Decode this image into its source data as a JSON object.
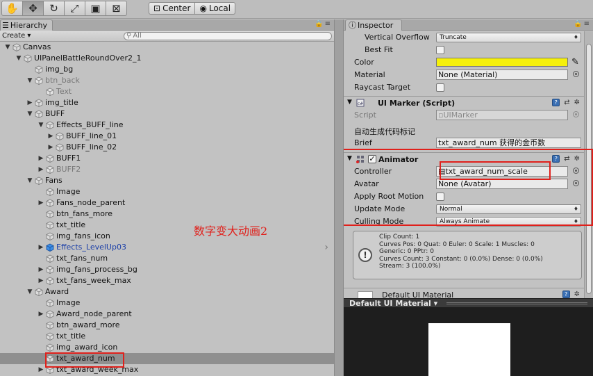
{
  "toolbar": {
    "tools": [
      {
        "icon": "hand-icon",
        "glyph": "✋"
      },
      {
        "icon": "move-icon",
        "glyph": "✥"
      },
      {
        "icon": "rotate-icon",
        "glyph": "↻"
      },
      {
        "icon": "scale-icon",
        "glyph": "⤢"
      },
      {
        "icon": "rect-icon",
        "glyph": "▣"
      },
      {
        "icon": "transform-icon",
        "glyph": "⊠"
      }
    ],
    "pivot": {
      "label": "Center"
    },
    "space": {
      "label": "Local"
    }
  },
  "hierarchy": {
    "tab_label": "Hierarchy",
    "create_label": "Create",
    "search_placeholder": "All",
    "rows": [
      {
        "label": "Canvas",
        "depth": 0,
        "arrow": "down",
        "state": "normal"
      },
      {
        "label": "UIPanelBattleRoundOver2_1",
        "depth": 1,
        "arrow": "down",
        "state": "normal"
      },
      {
        "label": "img_bg",
        "depth": 2,
        "arrow": "none",
        "state": "normal"
      },
      {
        "label": "btn_back",
        "depth": 2,
        "arrow": "down",
        "state": "inactive"
      },
      {
        "label": "Text",
        "depth": 3,
        "arrow": "none",
        "state": "inactive"
      },
      {
        "label": "img_title",
        "depth": 2,
        "arrow": "right",
        "state": "normal"
      },
      {
        "label": "BUFF",
        "depth": 2,
        "arrow": "down",
        "state": "normal"
      },
      {
        "label": "Effects_BUFF_line",
        "depth": 3,
        "arrow": "down",
        "state": "normal"
      },
      {
        "label": "BUFF_line_01",
        "depth": 4,
        "arrow": "right",
        "state": "normal"
      },
      {
        "label": "BUFF_line_02",
        "depth": 4,
        "arrow": "right",
        "state": "normal"
      },
      {
        "label": "BUFF1",
        "depth": 3,
        "arrow": "right",
        "state": "normal"
      },
      {
        "label": "BUFF2",
        "depth": 3,
        "arrow": "right",
        "state": "inactive"
      },
      {
        "label": "Fans",
        "depth": 2,
        "arrow": "down",
        "state": "normal"
      },
      {
        "label": "Image",
        "depth": 3,
        "arrow": "none",
        "state": "normal"
      },
      {
        "label": "Fans_node_parent",
        "depth": 3,
        "arrow": "right",
        "state": "normal"
      },
      {
        "label": "btn_fans_more",
        "depth": 3,
        "arrow": "none",
        "state": "normal"
      },
      {
        "label": "txt_title",
        "depth": 3,
        "arrow": "none",
        "state": "normal"
      },
      {
        "label": "img_fans_icon",
        "depth": 3,
        "arrow": "none",
        "state": "normal"
      },
      {
        "label": "Effects_LevelUp03",
        "depth": 3,
        "arrow": "right",
        "state": "prefab"
      },
      {
        "label": "txt_fans_num",
        "depth": 3,
        "arrow": "none",
        "state": "normal"
      },
      {
        "label": "img_fans_process_bg",
        "depth": 3,
        "arrow": "right",
        "state": "normal"
      },
      {
        "label": "txt_fans_week_max",
        "depth": 3,
        "arrow": "right",
        "state": "normal"
      },
      {
        "label": "Award",
        "depth": 2,
        "arrow": "down",
        "state": "normal"
      },
      {
        "label": "Image",
        "depth": 3,
        "arrow": "none",
        "state": "normal"
      },
      {
        "label": "Award_node_parent",
        "depth": 3,
        "arrow": "right",
        "state": "normal"
      },
      {
        "label": "btn_award_more",
        "depth": 3,
        "arrow": "none",
        "state": "normal"
      },
      {
        "label": "txt_title",
        "depth": 3,
        "arrow": "none",
        "state": "normal"
      },
      {
        "label": "img_award_icon",
        "depth": 3,
        "arrow": "none",
        "state": "normal"
      },
      {
        "label": "txt_award_num",
        "depth": 3,
        "arrow": "none",
        "state": "selected"
      },
      {
        "label": "txt_award_week_max",
        "depth": 3,
        "arrow": "right",
        "state": "normal"
      }
    ],
    "note": "数字变大动画2"
  },
  "inspector": {
    "tab_label": "Inspector",
    "text_props": {
      "vertical_overflow": {
        "label": "Vertical Overflow",
        "value": "Truncate"
      },
      "best_fit": {
        "label": "Best Fit"
      },
      "color": {
        "label": "Color",
        "value": "#f5f00a"
      },
      "material": {
        "label": "Material",
        "value": "None (Material)"
      },
      "raycast": {
        "label": "Raycast Target"
      }
    },
    "ui_marker": {
      "title": "UI Marker (Script)",
      "script_label": "Script",
      "script_value": "UIMarker",
      "auto_note": "自动生成代码标记",
      "brief_label": "Brief",
      "brief_value": "txt_award_num  获得的金币数"
    },
    "animator": {
      "title": "Animator",
      "controller_label": "Controller",
      "controller_value": "txt_award_num_scale",
      "avatar_label": "Avatar",
      "avatar_value": "None (Avatar)",
      "apply_root_label": "Apply Root Motion",
      "update_mode_label": "Update Mode",
      "update_mode_value": "Normal",
      "culling_mode_label": "Culling Mode",
      "culling_mode_value": "Always Animate",
      "info": "Clip Count: 1\nCurves Pos: 0 Quat: 0 Euler: 0 Scale: 1 Muscles: 0\nGeneric: 0 PPtr: 0\nCurves Count: 3 Constant: 0 (0.0%) Dense: 0 (0.0%)\nStream: 3 (100.0%)"
    },
    "material_header": "Default UI Material",
    "preview_title": "Default UI Material ▾"
  }
}
